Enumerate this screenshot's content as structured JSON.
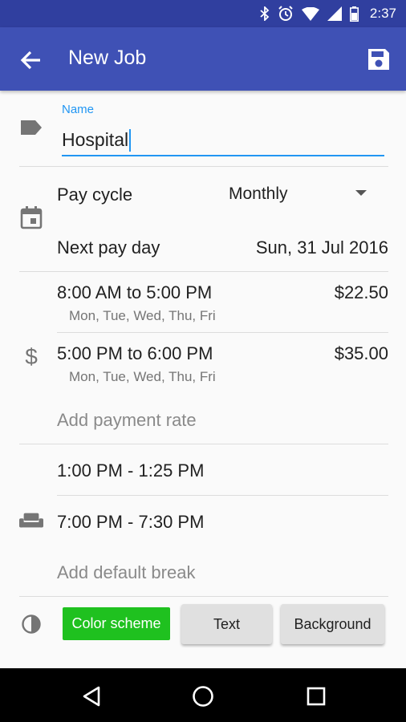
{
  "status_bar": {
    "time": "2:37",
    "icons": [
      "bluetooth-icon",
      "alarm-icon",
      "wifi-icon",
      "signal-icon",
      "battery-icon"
    ]
  },
  "app_bar": {
    "title": "New Job",
    "back_icon": "arrow-back-icon",
    "save_icon": "save-icon",
    "color": "#3f51b5"
  },
  "name_field": {
    "label": "Name",
    "value": "Hospital",
    "icon": "label-tag-icon"
  },
  "pay": {
    "icon": "calendar-icon",
    "cycle_label": "Pay cycle",
    "cycle_value": "Monthly",
    "next_label": "Next pay day",
    "next_value": "Sun, 31 Jul 2016"
  },
  "rates": {
    "icon": "dollar-icon",
    "items": [
      {
        "time": "8:00 AM to 5:00 PM",
        "days": "Mon, Tue, Wed, Thu, Fri",
        "amount": "$22.50"
      },
      {
        "time": "5:00 PM to 6:00 PM",
        "days": "Mon, Tue, Wed, Thu, Fri",
        "amount": "$35.00"
      }
    ],
    "add_label": "Add payment rate"
  },
  "breaks": {
    "icon": "couch-icon",
    "items": [
      "1:00 PM - 1:25 PM",
      "7:00 PM - 7:30 PM"
    ],
    "add_label": "Add default break"
  },
  "colors": {
    "icon": "contrast-icon",
    "scheme_label": "Color scheme",
    "scheme_color": "#1fc11f",
    "text_label": "Text",
    "background_label": "Background"
  },
  "nav": {
    "icons": [
      "back-triangle-icon",
      "home-circle-icon",
      "recents-square-icon"
    ]
  }
}
